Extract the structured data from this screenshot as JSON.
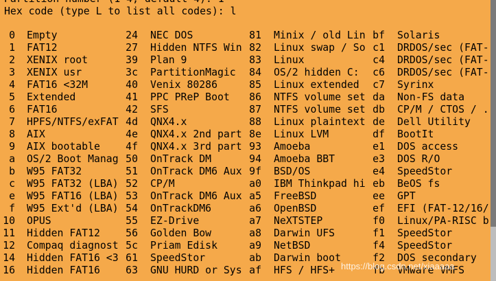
{
  "terminal": {
    "clipped_line": "Partition number (1-4, default 4): 1",
    "prompt_line": "Hex code (type L to list all codes): l"
  },
  "codes": [
    [
      [
        "0",
        "Empty"
      ],
      [
        "24",
        "NEC DOS"
      ],
      [
        "81",
        "Minix / old Lin"
      ],
      [
        "bf",
        "Solaris"
      ]
    ],
    [
      [
        "1",
        "FAT12"
      ],
      [
        "27",
        "Hidden NTFS Win"
      ],
      [
        "82",
        "Linux swap / So"
      ],
      [
        "c1",
        "DRDOS/sec (FAT-"
      ]
    ],
    [
      [
        "2",
        "XENIX root"
      ],
      [
        "39",
        "Plan 9"
      ],
      [
        "83",
        "Linux"
      ],
      [
        "c4",
        "DRDOS/sec (FAT-"
      ]
    ],
    [
      [
        "3",
        "XENIX usr"
      ],
      [
        "3c",
        "PartitionMagic"
      ],
      [
        "84",
        "OS/2 hidden C:"
      ],
      [
        "c6",
        "DRDOS/sec (FAT-"
      ]
    ],
    [
      [
        "4",
        "FAT16 <32M"
      ],
      [
        "40",
        "Venix 80286"
      ],
      [
        "85",
        "Linux extended"
      ],
      [
        "c7",
        "Syrinx"
      ]
    ],
    [
      [
        "5",
        "Extended"
      ],
      [
        "41",
        "PPC PReP Boot"
      ],
      [
        "86",
        "NTFS volume set"
      ],
      [
        "da",
        "Non-FS data"
      ]
    ],
    [
      [
        "6",
        "FAT16"
      ],
      [
        "42",
        "SFS"
      ],
      [
        "87",
        "NTFS volume set"
      ],
      [
        "db",
        "CP/M / CTOS / ."
      ]
    ],
    [
      [
        "7",
        "HPFS/NTFS/exFAT"
      ],
      [
        "4d",
        "QNX4.x"
      ],
      [
        "88",
        "Linux plaintext"
      ],
      [
        "de",
        "Dell Utility"
      ]
    ],
    [
      [
        "8",
        "AIX"
      ],
      [
        "4e",
        "QNX4.x 2nd part"
      ],
      [
        "8e",
        "Linux LVM"
      ],
      [
        "df",
        "BootIt"
      ]
    ],
    [
      [
        "9",
        "AIX bootable"
      ],
      [
        "4f",
        "QNX4.x 3rd part"
      ],
      [
        "93",
        "Amoeba"
      ],
      [
        "e1",
        "DOS access"
      ]
    ],
    [
      [
        "a",
        "OS/2 Boot Manag"
      ],
      [
        "50",
        "OnTrack DM"
      ],
      [
        "94",
        "Amoeba BBT"
      ],
      [
        "e3",
        "DOS R/O"
      ]
    ],
    [
      [
        "b",
        "W95 FAT32"
      ],
      [
        "51",
        "OnTrack DM6 Aux"
      ],
      [
        "9f",
        "BSD/OS"
      ],
      [
        "e4",
        "SpeedStor"
      ]
    ],
    [
      [
        "c",
        "W95 FAT32 (LBA)"
      ],
      [
        "52",
        "CP/M"
      ],
      [
        "a0",
        "IBM Thinkpad hi"
      ],
      [
        "eb",
        "BeOS fs"
      ]
    ],
    [
      [
        "e",
        "W95 FAT16 (LBA)"
      ],
      [
        "53",
        "OnTrack DM6 Aux"
      ],
      [
        "a5",
        "FreeBSD"
      ],
      [
        "ee",
        "GPT"
      ]
    ],
    [
      [
        "f",
        "W95 Ext'd (LBA)"
      ],
      [
        "54",
        "OnTrackDM6"
      ],
      [
        "a6",
        "OpenBSD"
      ],
      [
        "ef",
        "EFI (FAT-12/16/"
      ]
    ],
    [
      [
        "10",
        "OPUS"
      ],
      [
        "55",
        "EZ-Drive"
      ],
      [
        "a7",
        "NeXTSTEP"
      ],
      [
        "f0",
        "Linux/PA-RISC b"
      ]
    ],
    [
      [
        "11",
        "Hidden FAT12"
      ],
      [
        "56",
        "Golden Bow"
      ],
      [
        "a8",
        "Darwin UFS"
      ],
      [
        "f1",
        "SpeedStor"
      ]
    ],
    [
      [
        "12",
        "Compaq diagnost"
      ],
      [
        "5c",
        "Priam Edisk"
      ],
      [
        "a9",
        "NetBSD"
      ],
      [
        "f4",
        "SpeedStor"
      ]
    ],
    [
      [
        "14",
        "Hidden FAT16 <3"
      ],
      [
        "61",
        "SpeedStor"
      ],
      [
        "ab",
        "Darwin boot"
      ],
      [
        "f2",
        "DOS secondary"
      ]
    ],
    [
      [
        "16",
        "Hidden FAT16"
      ],
      [
        "63",
        "GNU HURD or Sys"
      ],
      [
        "af",
        "HFS / HFS+"
      ],
      [
        "fb",
        "VMware VMFS"
      ]
    ]
  ],
  "watermark": "https://blog.csdn.net/xiaaaaa",
  "colors": {
    "background": "#f5a94a",
    "text": "#000000",
    "scrollbar": "#7a7a7a"
  }
}
